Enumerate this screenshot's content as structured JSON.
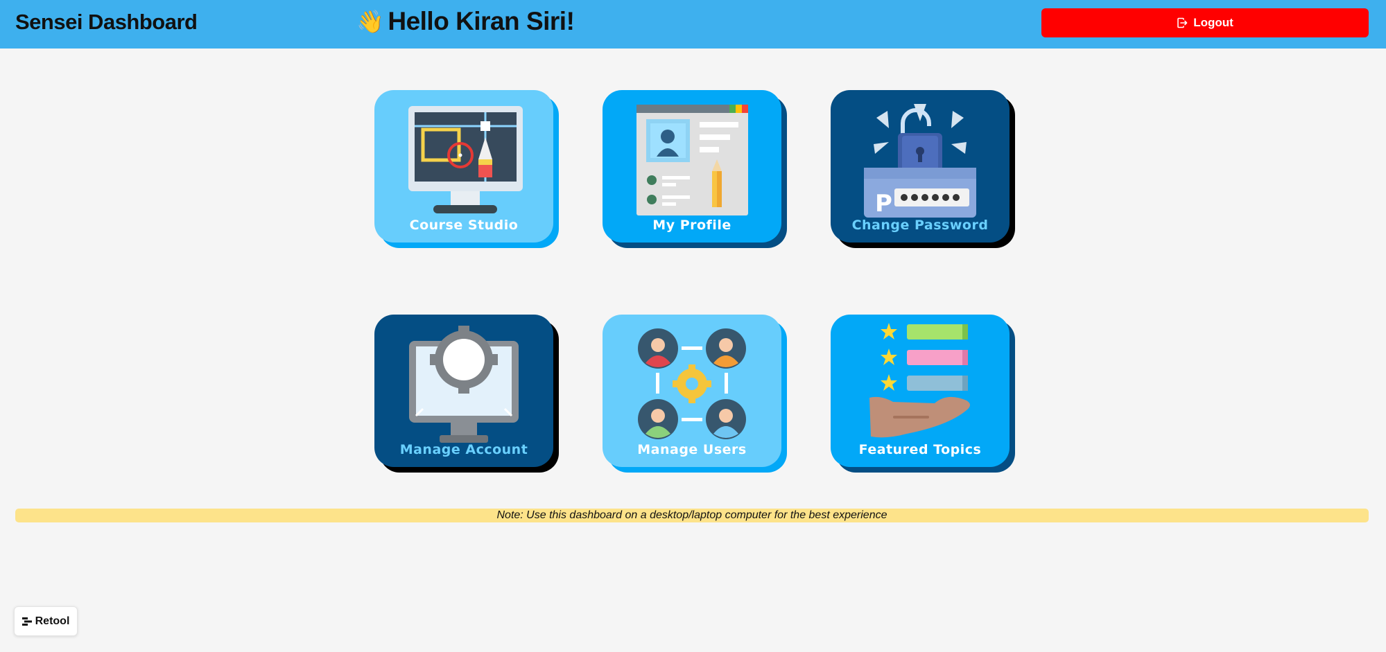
{
  "header": {
    "brand": "Sensei Dashboard",
    "wave_emoji": "👋",
    "greeting": "Hello Kiran Siri!",
    "logout_label": "Logout"
  },
  "tiles": [
    {
      "label": "Course Studio",
      "icon": "monitor-pen-icon"
    },
    {
      "label": "My Profile",
      "icon": "profile-card-icon"
    },
    {
      "label": "Change Password",
      "icon": "padlock-password-icon"
    },
    {
      "label": "Manage Account",
      "icon": "monitor-gear-icon"
    },
    {
      "label": "Manage Users",
      "icon": "users-network-icon"
    },
    {
      "label": "Featured Topics",
      "icon": "hand-stars-icon"
    }
  ],
  "note": "Note: Use this dashboard on a desktop/laptop computer for the best experience",
  "footer": {
    "retool_label": "Retool"
  },
  "colors": {
    "header_bg": "#3eb0ee",
    "logout_bg": "#ff0000",
    "note_bg": "#fde38a",
    "tile_light": "#67cdfc",
    "tile_mid": "#02a8f7",
    "tile_dark": "#044e84"
  }
}
